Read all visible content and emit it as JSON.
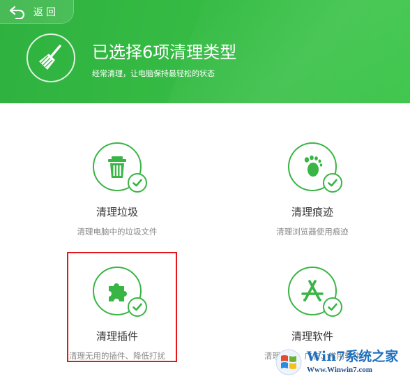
{
  "header": {
    "back_label": "返回",
    "title": "已选择6项清理类型",
    "subtitle": "经常清理，让电脑保持最轻松的状态"
  },
  "cards": [
    {
      "title": "清理垃圾",
      "desc": "清理电脑中的垃圾文件",
      "icon": "trash-icon",
      "checked": true
    },
    {
      "title": "清理痕迹",
      "desc": "清理浏览器使用痕迹",
      "icon": "footprint-icon",
      "checked": true
    },
    {
      "title": "清理插件",
      "desc": "清理无用的插件、降低打扰",
      "icon": "puzzle-icon",
      "checked": true
    },
    {
      "title": "清理软件",
      "desc": "清理推广、广告、常用软件",
      "icon": "app-store-icon",
      "checked": true
    }
  ],
  "watermark": {
    "brand": "Win7系统之家",
    "url": "Www.Winwin7.com"
  },
  "colors": {
    "header_green": "#35bb44",
    "icon_green": "#38b544",
    "highlight_red": "#e3161b"
  }
}
